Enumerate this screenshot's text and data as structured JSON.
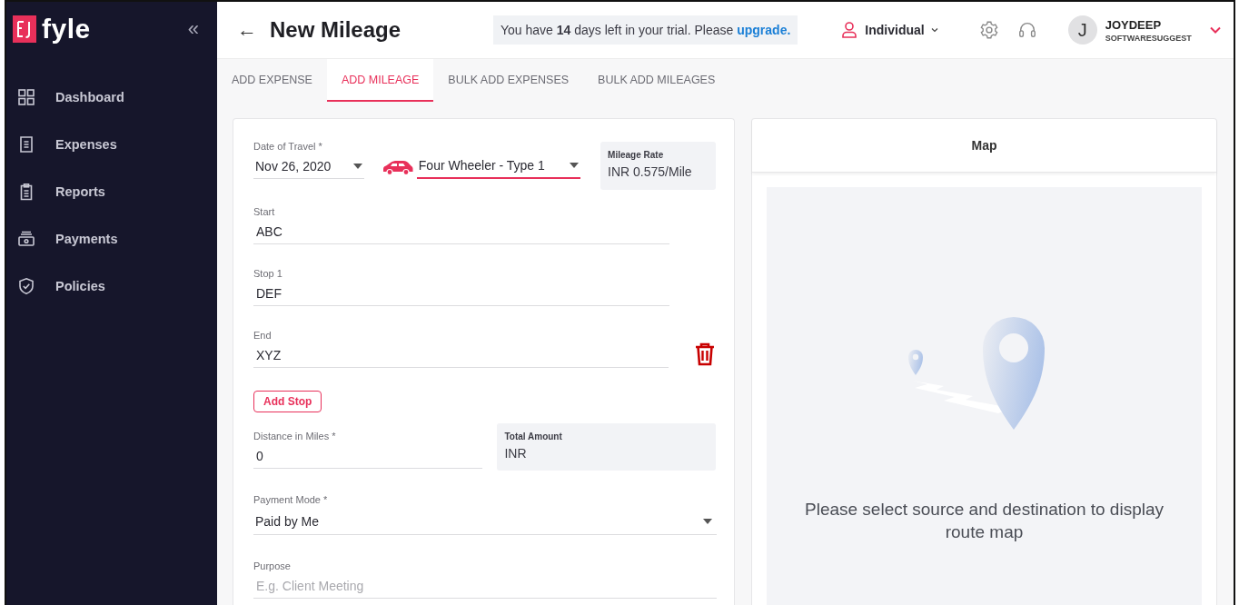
{
  "sidebar": {
    "logo": "fyle",
    "collapse": "«",
    "items": [
      {
        "label": "Dashboard",
        "kind": "grid",
        "selected": false
      },
      {
        "label": "Expenses",
        "kind": "receipt",
        "selected": false
      },
      {
        "label": "Reports",
        "kind": "clipboard",
        "selected": false
      },
      {
        "label": "Payments",
        "kind": "cash",
        "selected": false
      },
      {
        "label": "Policies",
        "kind": "shield",
        "selected": false
      }
    ]
  },
  "header": {
    "back": "←",
    "title": "New Mileage",
    "trial": {
      "text": "You have **14** days left in your trial. Please",
      "link": "upgrade."
    },
    "mode": "Individual",
    "user": {
      "initial": "J",
      "name": "JOYDEEP",
      "org": "SOFTWARESUGGEST"
    }
  },
  "tabs": [
    {
      "label": "ADD EXPENSE",
      "selected": false
    },
    {
      "label": "ADD MILEAGE",
      "selected": true
    },
    {
      "label": "BULK ADD EXPENSES",
      "selected": false
    },
    {
      "label": "BULK ADD MILEAGES",
      "selected": false
    }
  ],
  "form": {
    "date": {
      "label": "Date of Travel *",
      "value": "Nov 26, 2020"
    },
    "vehicle": {
      "value": "Four Wheeler - Type 1",
      "focused": true
    },
    "mileage_rate": {
      "label": "Mileage Rate",
      "value": "INR 0.575/Mile"
    },
    "stops": [
      {
        "label": "Start",
        "value": "ABC",
        "removable": false
      },
      {
        "label": "Stop 1",
        "value": "DEF",
        "removable": false
      },
      {
        "label": "End",
        "value": "XYZ",
        "removable": true
      }
    ],
    "add_stop": "Add Stop",
    "distance": {
      "label": "Distance in Miles *",
      "value": "0"
    },
    "total_amount": {
      "label": "Total Amount",
      "value": "INR"
    },
    "payment_mode": {
      "label": "Payment Mode *",
      "value": "Paid by Me"
    },
    "purpose": {
      "label": "Purpose",
      "placeholder": "E.g. Client Meeting"
    }
  },
  "map": {
    "title": "Map",
    "message": "Please select source and destination to display route map"
  }
}
